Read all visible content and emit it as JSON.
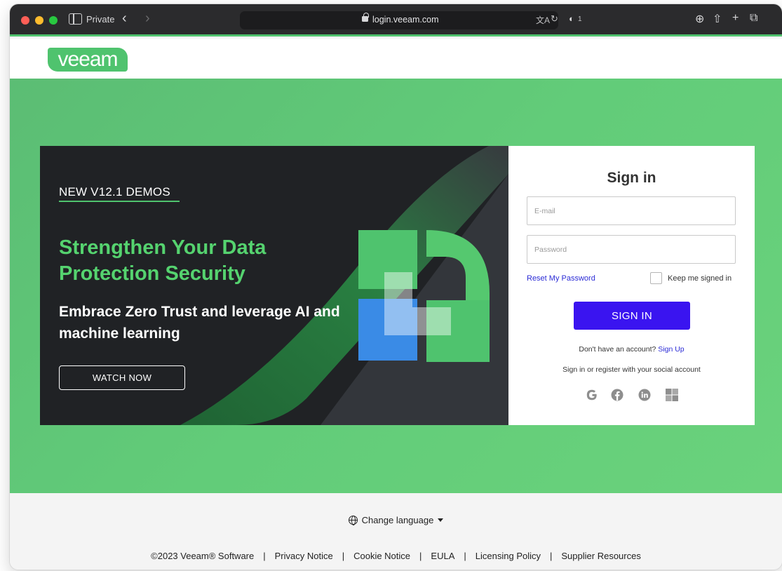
{
  "browser": {
    "private_label": "Private",
    "url": "login.veeam.com",
    "shield_count": "1"
  },
  "header": {
    "logo_text": "veeam"
  },
  "promo": {
    "eyebrow": "NEW V12.1 DEMOS",
    "headline": "Strengthen Your Data Protection Security",
    "subheadline": "Embrace Zero Trust and leverage AI and machine learning",
    "cta": "WATCH NOW"
  },
  "signin": {
    "title": "Sign in",
    "email_placeholder": "E-mail",
    "password_placeholder": "Password",
    "reset_link": "Reset My Password",
    "keep_signed_in": "Keep me signed in",
    "keep_signed_in_checked": false,
    "submit": "SIGN IN",
    "no_account_text": "Don't have an account?",
    "signup_link": "Sign Up",
    "social_text": "Sign in or register with your social account",
    "social_icons": [
      "google-icon",
      "facebook-icon",
      "linkedin-icon",
      "microsoft-icon"
    ]
  },
  "footer": {
    "language": "Change language",
    "links": [
      "©2023 Veeam® Software",
      "Privacy Notice",
      "Cookie Notice",
      "EULA",
      "Licensing Policy",
      "Supplier Resources"
    ]
  },
  "colors": {
    "brand_green": "#4fc36e",
    "signin_button": "#3a14f0",
    "link_blue": "#2b2bd6"
  }
}
